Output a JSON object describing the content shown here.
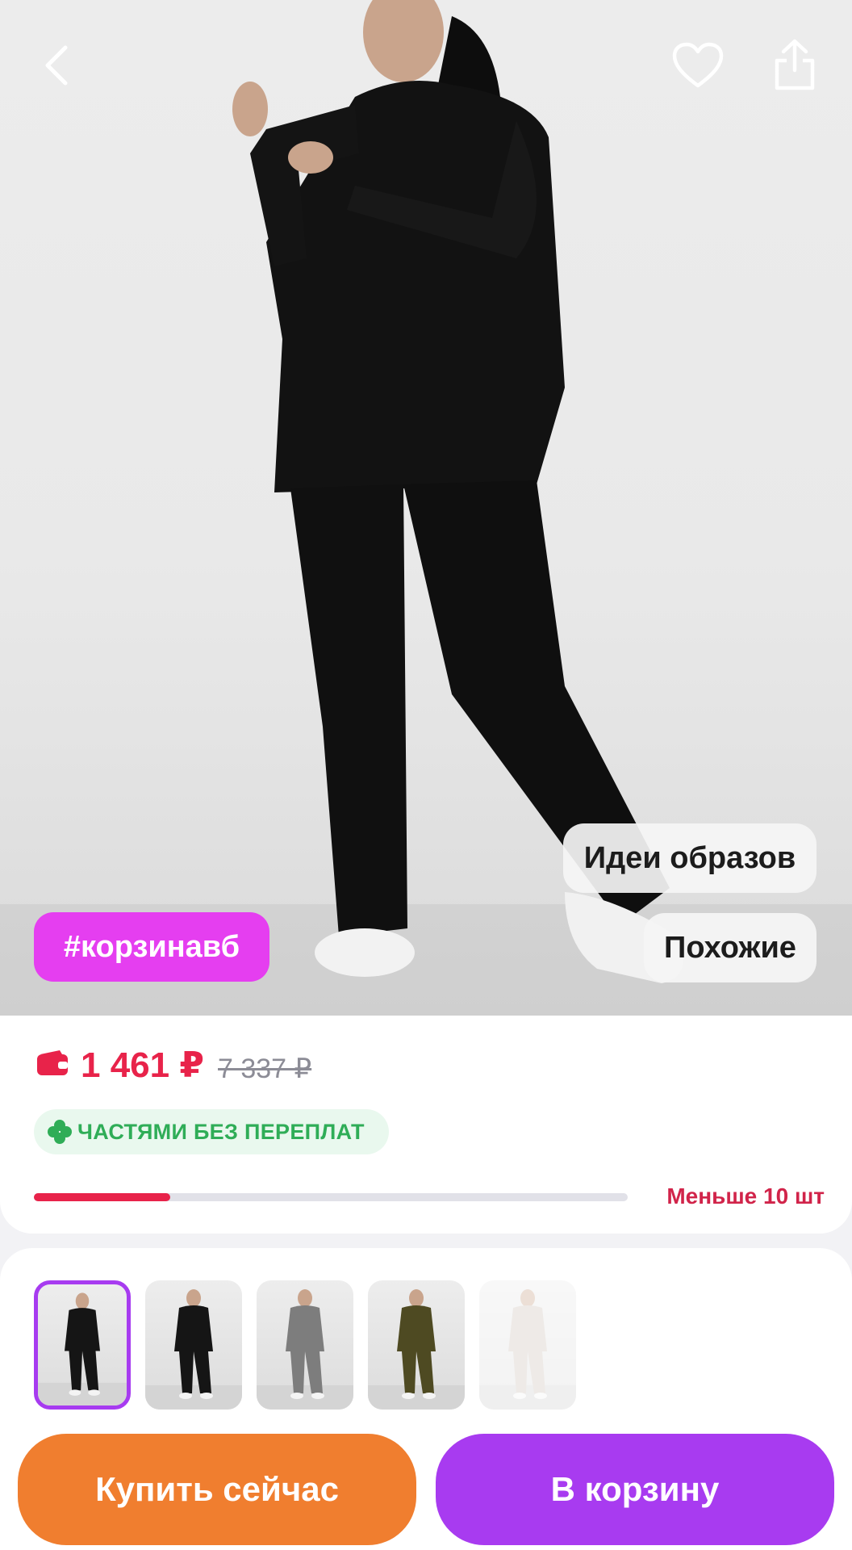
{
  "product": {
    "hashtag": "#корзинавб",
    "ideas_label": "Идеи образов",
    "similar_label": "Похожие"
  },
  "pricing": {
    "price": "1 461 ₽",
    "old_price": "7 337 ₽",
    "installment_label": "ЧАСТЯМИ БЕЗ ПЕРЕПЛАТ",
    "stock_text": "Меньше 10 шт",
    "stock_fill_fraction": 0.23
  },
  "gallery": {
    "thumbnails": [
      {
        "name": "black-front",
        "color": "#151515",
        "selected": true
      },
      {
        "name": "black-side",
        "color": "#151515",
        "selected": false
      },
      {
        "name": "grey",
        "color": "#7d7d7d",
        "selected": false
      },
      {
        "name": "olive",
        "color": "#4e4a22",
        "selected": false
      },
      {
        "name": "beige",
        "color": "#cfc6bc",
        "selected": false
      }
    ]
  },
  "actions": {
    "buy_now": "Купить сейчас",
    "add_to_cart": "В корзину"
  },
  "colors": {
    "price_red": "#e8234a",
    "hashtag_pink": "#e53ef0",
    "buy_orange": "#f07e2f",
    "cart_purple": "#a83bf0",
    "installment_green": "#2fad57"
  },
  "icons": {
    "back": "chevron-left-icon",
    "favorite": "heart-icon",
    "share": "share-icon",
    "wallet": "wallet-icon",
    "installment": "clover-icon"
  }
}
